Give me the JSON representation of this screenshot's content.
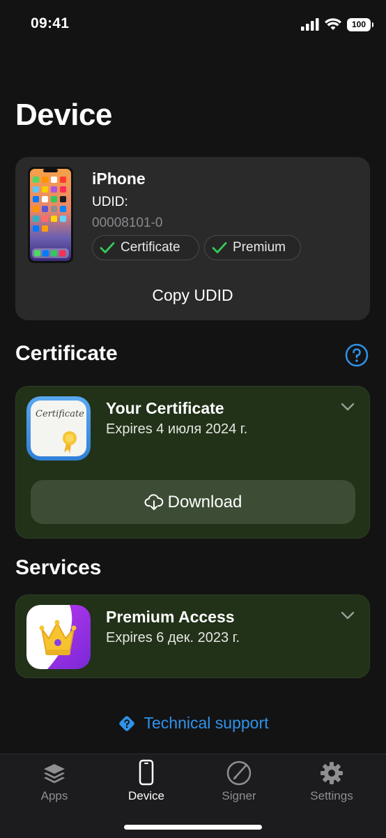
{
  "status_bar": {
    "time": "09:41",
    "battery": "100"
  },
  "page": {
    "title": "Device"
  },
  "device": {
    "name": "iPhone",
    "udid_label": "UDID:",
    "udid_value": "00008101-0",
    "badges": [
      {
        "label": "Certificate",
        "state": "checked"
      },
      {
        "label": "Premium",
        "state": "checked"
      }
    ],
    "copy_label": "Copy UDID"
  },
  "certificate_section": {
    "title": "Certificate",
    "card": {
      "icon_text": "Certificate",
      "title": "Your Certificate",
      "expires": "Expires 4 июля 2024 г.",
      "download_label": "Download"
    }
  },
  "services_section": {
    "title": "Services",
    "card": {
      "title": "Premium Access",
      "expires": "Expires 6 дек. 2023 г."
    }
  },
  "support": {
    "label": "Technical support"
  },
  "tabbar": {
    "tabs": [
      {
        "label": "Apps",
        "icon": "layers-icon",
        "active": false
      },
      {
        "label": "Device",
        "icon": "phone-icon",
        "active": true
      },
      {
        "label": "Signer",
        "icon": "signer-icon",
        "active": false
      },
      {
        "label": "Settings",
        "icon": "gear-icon",
        "active": false
      }
    ]
  },
  "colors": {
    "background": "#131314",
    "card": "#2a2a2b",
    "green_card": "#223219",
    "accent_blue": "#2f93ea",
    "check_green": "#34c759"
  }
}
